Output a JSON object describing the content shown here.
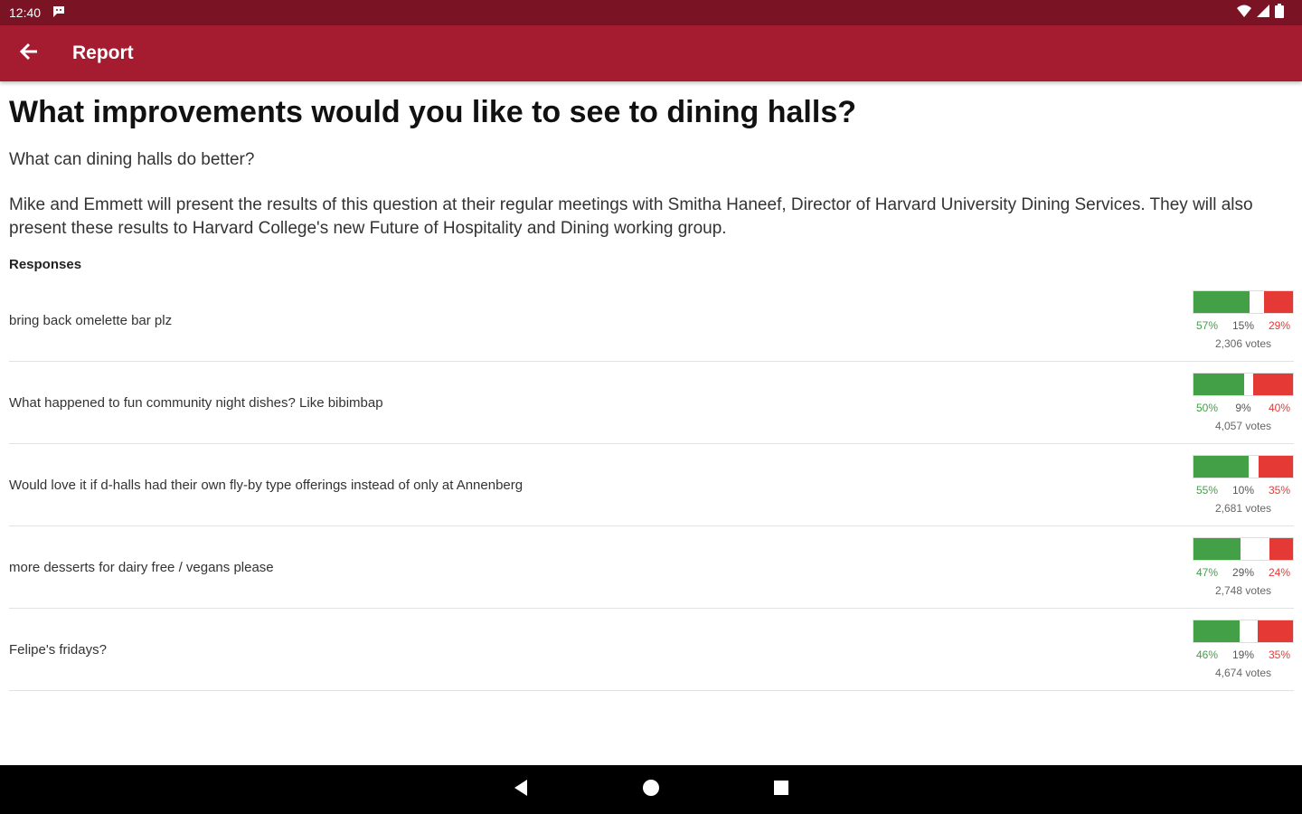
{
  "status_bar": {
    "time": "12:40",
    "icons": [
      "notification-icon",
      "wifi-icon",
      "signal-icon",
      "battery-icon"
    ]
  },
  "app_bar": {
    "title": "Report",
    "back_icon": "arrow-back-icon"
  },
  "question": {
    "title": "What improvements would you like to see to dining halls?",
    "subtitle": "What can dining halls do better?",
    "body": "Mike and Emmett will present the results of this question at their regular meetings with Smitha Haneef, Director of Harvard University Dining Services. They will also present these results to Harvard College's new Future of Hospitality and Dining working group."
  },
  "responses": {
    "heading": "Responses",
    "items": [
      {
        "text": "bring back omelette bar plz",
        "agree": 57,
        "pass": 15,
        "disagree": 29,
        "agree_label": "57%",
        "pass_label": "15%",
        "disagree_label": "29%",
        "votes": "2,306 votes"
      },
      {
        "text": "What happened to fun community night dishes? Like bibimbap",
        "agree": 50,
        "pass": 9,
        "disagree": 40,
        "agree_label": "50%",
        "pass_label": "9%",
        "disagree_label": "40%",
        "votes": "4,057 votes"
      },
      {
        "text": "Would love it if d-halls had their own fly-by type offerings instead of only at Annenberg",
        "agree": 55,
        "pass": 10,
        "disagree": 35,
        "agree_label": "55%",
        "pass_label": "10%",
        "disagree_label": "35%",
        "votes": "2,681 votes"
      },
      {
        "text": "more desserts for dairy free / vegans please",
        "agree": 47,
        "pass": 29,
        "disagree": 24,
        "agree_label": "47%",
        "pass_label": "29%",
        "disagree_label": "24%",
        "votes": "2,748 votes"
      },
      {
        "text": "Felipe's fridays?",
        "agree": 46,
        "pass": 19,
        "disagree": 35,
        "agree_label": "46%",
        "pass_label": "19%",
        "disagree_label": "35%",
        "votes": "4,674 votes"
      }
    ]
  },
  "nav_bar": {
    "icons": [
      "nav-back-icon",
      "nav-home-icon",
      "nav-recents-icon"
    ]
  },
  "colors": {
    "status_bar": "#7a1424",
    "app_bar": "#a51c30",
    "agree": "#43a047",
    "disagree": "#e53935"
  }
}
